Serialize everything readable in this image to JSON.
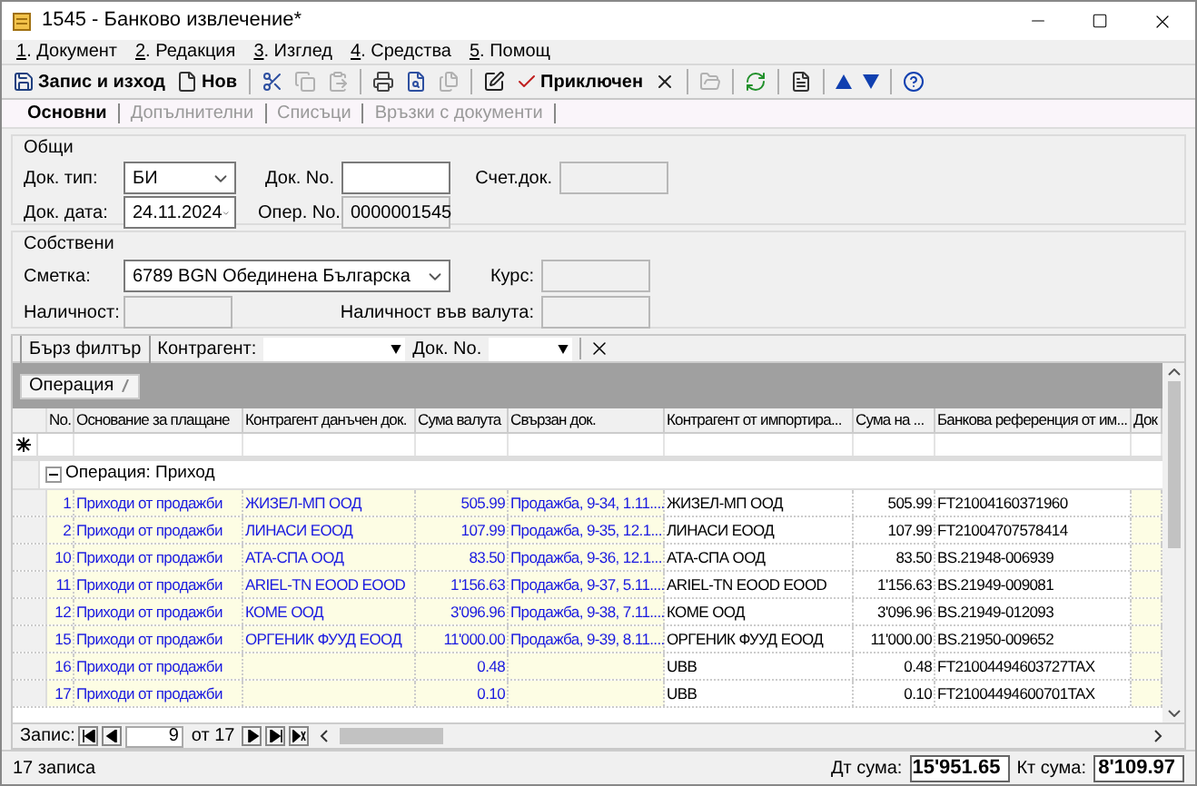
{
  "window": {
    "title": "1545 - Банково извлечение*"
  },
  "menu": [
    "1. Документ",
    "2. Редакция",
    "3. Изглед",
    "4. Средства",
    "5. Помощ"
  ],
  "toolbar": [
    {
      "label": "Запис и изход",
      "disabled": false
    },
    {
      "label": "Нов",
      "disabled": false
    },
    {
      "disabled": false
    },
    {
      "disabled": true
    },
    {
      "disabled": true
    },
    {
      "disabled": false
    },
    {
      "disabled": false
    },
    {
      "disabled": true
    },
    {
      "disabled": false
    },
    {
      "label": "Приключен",
      "disabled": false
    },
    {
      "disabled": false
    },
    {
      "disabled": true
    },
    {
      "disabled": false
    },
    {
      "disabled": false
    },
    {
      "disabled": false
    },
    {
      "disabled": false
    },
    {
      "disabled": false
    }
  ],
  "tabs": [
    {
      "label": "Основни",
      "selected": true
    },
    {
      "label": "Допълнителни",
      "selected": false
    },
    {
      "label": "Списъци",
      "selected": false
    },
    {
      "label": "Връзки с документи",
      "selected": false
    }
  ],
  "general": {
    "title": "Общи",
    "doc_type": {
      "label": "Док. тип:",
      "value": "БИ",
      "kind": "dropdown",
      "disabled": false
    },
    "doc_no": {
      "label": "Док. No.",
      "kind": "text",
      "disabled": false
    },
    "acc_doc": {
      "label": "Счет.док.",
      "kind": "text",
      "disabled": true
    },
    "doc_date": {
      "label": "Док. дата:",
      "value": "24.11.2024",
      "kind": "dropdown",
      "disabled": false
    },
    "oper_no": {
      "label": "Опер. No.",
      "value": "0000001545",
      "kind": "text",
      "disabled": true
    }
  },
  "own": {
    "title": "Собствени",
    "account": {
      "label": "Сметка:",
      "value": "6789 BGN Обединена Българска",
      "kind": "dropdown",
      "disabled": false
    },
    "rate": {
      "label": "Курс:",
      "kind": "text",
      "disabled": true
    },
    "balance": {
      "label": "Наличност:",
      "kind": "text",
      "disabled": true
    },
    "balance_currency": {
      "label": "Наличност във валута:",
      "kind": "text",
      "disabled": true
    }
  },
  "filter": {
    "title": "Бърз филтър",
    "counterparty_label": "Контрагент:",
    "doc_no_label": "Док. No."
  },
  "grouping": {
    "column": "Операция"
  },
  "table": {
    "columns": [
      "No.",
      "Основание за плащане",
      "Контрагент данъчен док.",
      "Сума валута",
      "Свързан док.",
      "Контрагент от импортира...",
      "Сума на ...",
      "Банкова референция от им...",
      "Док"
    ],
    "group": {
      "label": "Операция: Приход",
      "expanded": true
    },
    "rows": [
      {
        "no": "1",
        "basis": "Приходи от продажби",
        "counterparty": "ЖИЗЕЛ-МП ООД",
        "amount": "505.99",
        "linked": "Продажба, 9-34, 1.11....",
        "import_counterparty": "ЖИЗЕЛ-МП ООД",
        "import_amount": "505.99",
        "bank_ref": "FT21004160371960"
      },
      {
        "no": "2",
        "basis": "Приходи от продажби",
        "counterparty": "ЛИНАСИ ЕООД",
        "amount": "107.99",
        "linked": "Продажба, 9-35, 12.1...",
        "import_counterparty": "ЛИНАСИ ЕООД",
        "import_amount": "107.99",
        "bank_ref": "FT21004707578414"
      },
      {
        "no": "10",
        "basis": "Приходи от продажби",
        "counterparty": "АТА-СПА ООД",
        "amount": "83.50",
        "linked": "Продажба, 9-36, 12.1...",
        "import_counterparty": "АТА-СПА ООД",
        "import_amount": "83.50",
        "bank_ref": "BS.21948-006939"
      },
      {
        "no": "11",
        "basis": "Приходи от продажби",
        "counterparty": "ARIEL-TN EOOD EOOD",
        "amount": "1'156.63",
        "linked": "Продажба, 9-37, 5.11....",
        "import_counterparty": "ARIEL-TN EOOD EOOD",
        "import_amount": "1'156.63",
        "bank_ref": "BS.21949-009081"
      },
      {
        "no": "12",
        "basis": "Приходи от продажби",
        "counterparty": "КОМЕ ООД",
        "amount": "3'096.96",
        "linked": "Продажба, 9-38, 7.11....",
        "import_counterparty": "КОМЕ ООД",
        "import_amount": "3'096.96",
        "bank_ref": "BS.21949-012093"
      },
      {
        "no": "15",
        "basis": "Приходи от продажби",
        "counterparty": "ОРГЕНИК ФУУД ЕООД",
        "amount": "11'000.00",
        "linked": "Продажба, 9-39, 8.11....",
        "import_counterparty": "ОРГЕНИК ФУУД ЕООД",
        "import_amount": "11'000.00",
        "bank_ref": "BS.21950-009652"
      },
      {
        "no": "16",
        "basis": "Приходи от продажби",
        "amount": "0.48",
        "import_counterparty": "UBB",
        "import_amount": "0.48",
        "bank_ref": "FT21004494603727TAX"
      },
      {
        "no": "17",
        "basis": "Приходи от продажби",
        "amount": "0.10",
        "import_counterparty": "UBB",
        "import_amount": "0.10",
        "bank_ref": "FT21004494600701TAX"
      }
    ]
  },
  "navigator": {
    "label": "Запис:",
    "current": "9",
    "total": "от 17"
  },
  "status_bar": {
    "count": "17 записа",
    "debit_label": "Дт сума:",
    "debit": "15'951.65",
    "credit_label": "Кт сума:",
    "credit": "8'109.97"
  }
}
